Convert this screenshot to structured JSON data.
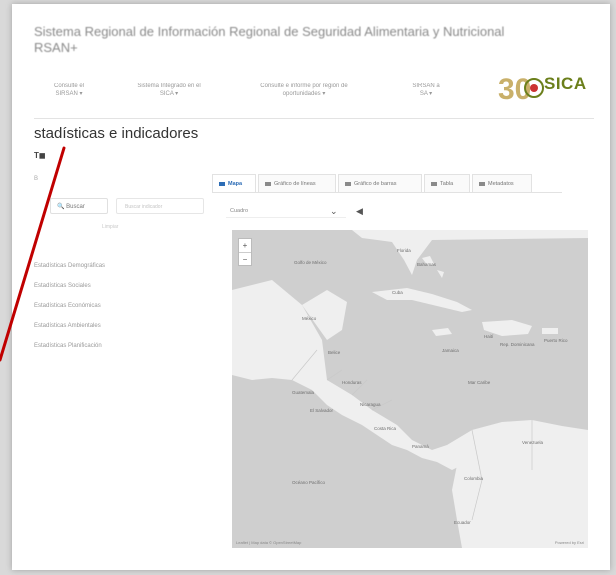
{
  "header": {
    "title_line1": "Sistema Regional de Información Regional de Seguridad Alimentaria y Nutricional",
    "title_line2": "RSAN+"
  },
  "nav": {
    "items": [
      {
        "line1": "Consulte el",
        "line2": "SIRSAN ▾"
      },
      {
        "line1": "Sistema Integrado en el",
        "line2": "SICA ▾"
      },
      {
        "line1": "Consulte e informe por región de",
        "line2": "oportunidades ▾"
      },
      {
        "line1": "SIRSAN a",
        "line2": "SA ▾"
      }
    ]
  },
  "logo": {
    "number": "30",
    "text": "SICA",
    "color": "#6b7f1b"
  },
  "section": {
    "title": "stadísticas e indicadores",
    "subtitle": "T◼"
  },
  "left": {
    "hint": "B",
    "search_label": "Buscar",
    "filter_placeholder": "Buscar indicador",
    "small_link": "Limpiar",
    "tree": [
      "Estadísticas Demográficas",
      "Estadísticas Sociales",
      "Estadísticas Económicas",
      "Estadísticas Ambientales",
      "Estadísticas Planificación"
    ]
  },
  "tabs": [
    {
      "label": "Mapa",
      "active": true
    },
    {
      "label": "Gráfico de líneas",
      "active": false
    },
    {
      "label": "Gráfico de barras",
      "active": false
    },
    {
      "label": "Tabla",
      "active": false
    },
    {
      "label": "Metadatos",
      "active": false
    }
  ],
  "controls": {
    "select_value": "Cuadro",
    "chevron": "⌄",
    "action_icon": "◀"
  },
  "map": {
    "zoom_in": "+",
    "zoom_out": "−",
    "labels": [
      "Florida",
      "Bahamas",
      "Cuba",
      "Golfo de México",
      "México",
      "Jamaica",
      "Haití",
      "Rep. Dominicana",
      "Puerto Rico",
      "Belice",
      "Guatemala",
      "Honduras",
      "El Salvador",
      "Nicaragua",
      "Costa Rica",
      "Panamá",
      "Mar Caribe",
      "Venezuela",
      "Colombia",
      "Ecuador",
      "Océano Pacífico"
    ],
    "attribution_left": "Leaflet | Map data © OpenStreetMap",
    "attribution_right": "Powered by Esri",
    "land_color": "#efefef",
    "water_color": "#cfcfcf"
  },
  "annotation": {
    "arrow_color": "#c00000"
  }
}
